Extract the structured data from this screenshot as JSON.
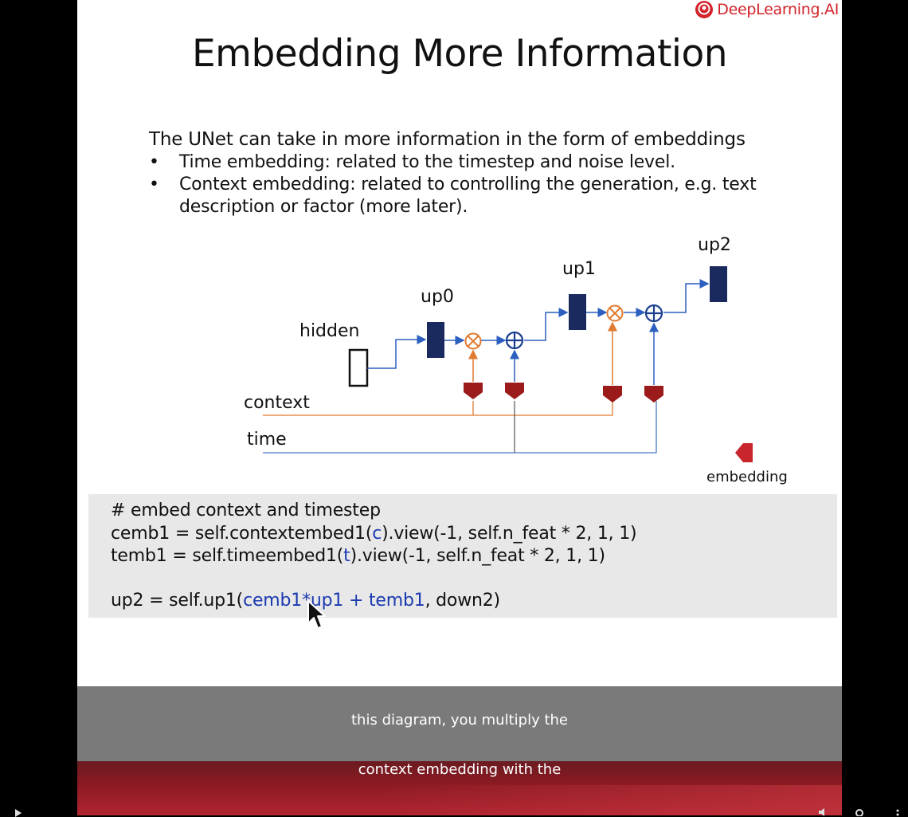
{
  "brand": {
    "logo_text": "DeepLearning.AI",
    "color": "#d2232a"
  },
  "slide": {
    "title": "Embedding More Information",
    "intro": "The UNet can take in more information in the form of embeddings",
    "bullets": [
      "Time embedding: related to the timestep and noise level.",
      "Context embedding: related to controlling the generation, e.g. text description or factor (more later)."
    ]
  },
  "diagram": {
    "labels": {
      "hidden": "hidden",
      "up0": "up0",
      "up1": "up1",
      "up2": "up2",
      "context": "context",
      "time": "time",
      "legend": "embedding"
    },
    "colors": {
      "block": "#1b2a5e",
      "embedding": "#9b1b1b",
      "context_line": "#e07a30",
      "time_line": "#4a78c4",
      "multiply": "#e07a30",
      "add": "#1b3f8f"
    }
  },
  "code": {
    "line1": "# embed context and timestep",
    "line2_a": "cemb1 = self.contextembed1(",
    "line2_b": "c",
    "line2_c": ").view(-1, self.n_feat * 2, 1, 1)",
    "line3_a": "temb1 = self.timeembed1(",
    "line3_b": "t",
    "line3_c": ").view(-1, self.n_feat * 2, 1, 1)",
    "line4_a": "up2 = self.up1(",
    "line4_b": "cemb1*up1 + temb1",
    "line4_c": ", down2)"
  },
  "captions": {
    "line1": "this diagram, you multiply the",
    "line2": "context embedding with the"
  }
}
